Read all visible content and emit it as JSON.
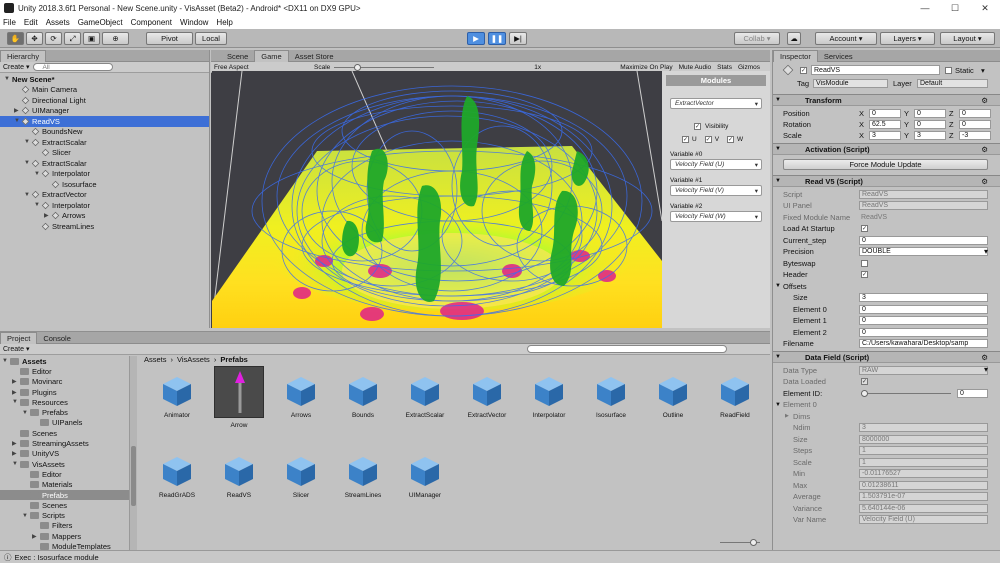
{
  "window": {
    "title": "Unity 2018.3.6f1 Personal - New Scene.unity - VisAsset (Beta2) - Android* <DX11 on DX9 GPU>"
  },
  "menu": [
    "File",
    "Edit",
    "Assets",
    "GameObject",
    "Component",
    "Window",
    "Help"
  ],
  "toolbar": {
    "pivot": "Pivot",
    "local": "Local",
    "collab": "Collab",
    "account": "Account",
    "layers": "Layers",
    "layout": "Layout"
  },
  "hierarchy": {
    "tab": "Hierarchy",
    "create": "Create",
    "search": "All",
    "items": [
      {
        "label": "New Scene*",
        "depth": 0,
        "bold": true,
        "exp": "▼",
        "cube": false
      },
      {
        "label": "Main Camera",
        "depth": 1,
        "exp": "",
        "cube": true
      },
      {
        "label": "Directional Light",
        "depth": 1,
        "exp": "",
        "cube": true
      },
      {
        "label": "UIManager",
        "depth": 1,
        "exp": "▶",
        "cube": true
      },
      {
        "label": "ReadVS",
        "depth": 1,
        "exp": "▼",
        "cube": true,
        "sel": true
      },
      {
        "label": "BoundsNew",
        "depth": 2,
        "exp": "",
        "cube": true
      },
      {
        "label": "ExtractScalar",
        "depth": 2,
        "exp": "▼",
        "cube": true
      },
      {
        "label": "Slicer",
        "depth": 3,
        "exp": "",
        "cube": true
      },
      {
        "label": "ExtractScalar",
        "depth": 2,
        "exp": "▼",
        "cube": true
      },
      {
        "label": "Interpolator",
        "depth": 3,
        "exp": "▼",
        "cube": true
      },
      {
        "label": "Isosurface",
        "depth": 4,
        "exp": "",
        "cube": true
      },
      {
        "label": "ExtractVector",
        "depth": 2,
        "exp": "▼",
        "cube": true
      },
      {
        "label": "Interpolator",
        "depth": 3,
        "exp": "▼",
        "cube": true
      },
      {
        "label": "Arrows",
        "depth": 4,
        "exp": "▶",
        "cube": true
      },
      {
        "label": "StreamLines",
        "depth": 3,
        "exp": "",
        "cube": true
      }
    ]
  },
  "scene_tabs": [
    "Scene",
    "Game",
    "Asset Store"
  ],
  "game": {
    "aspect": "Free Aspect",
    "scale_label": "Scale",
    "scale_value": "1x",
    "toggles": [
      "Maximize On Play",
      "Mute Audio",
      "Stats",
      "Gizmos"
    ],
    "modules": {
      "title": "Modules",
      "module_select": "ExtractVector",
      "visibility": "Visibility",
      "uvw": [
        "U",
        "V",
        "W"
      ],
      "variables": [
        {
          "label": "Variable #0",
          "value": "Velocity Field (U)"
        },
        {
          "label": "Variable #1",
          "value": "Velocity Field (V)"
        },
        {
          "label": "Variable #2",
          "value": "Velocity Field (W)"
        }
      ]
    }
  },
  "project": {
    "tabs": [
      "Project",
      "Console"
    ],
    "create": "Create",
    "breadcrumb": [
      "Assets",
      "VisAssets",
      "Prefabs"
    ],
    "tree": [
      {
        "label": "Assets",
        "depth": 0,
        "exp": "▼",
        "bold": true
      },
      {
        "label": "Editor",
        "depth": 1,
        "exp": ""
      },
      {
        "label": "Movinarc",
        "depth": 1,
        "exp": "▶"
      },
      {
        "label": "Plugins",
        "depth": 1,
        "exp": "▶"
      },
      {
        "label": "Resources",
        "depth": 1,
        "exp": "▼"
      },
      {
        "label": "Prefabs",
        "depth": 2,
        "exp": "▼"
      },
      {
        "label": "UIPanels",
        "depth": 3,
        "exp": ""
      },
      {
        "label": "Scenes",
        "depth": 1,
        "exp": ""
      },
      {
        "label": "StreamingAssets",
        "depth": 1,
        "exp": "▶"
      },
      {
        "label": "UnityVS",
        "depth": 1,
        "exp": "▶"
      },
      {
        "label": "VisAssets",
        "depth": 1,
        "exp": "▼"
      },
      {
        "label": "Editor",
        "depth": 2,
        "exp": ""
      },
      {
        "label": "Materials",
        "depth": 2,
        "exp": ""
      },
      {
        "label": "Prefabs",
        "depth": 2,
        "exp": "",
        "sel": true
      },
      {
        "label": "Scenes",
        "depth": 2,
        "exp": ""
      },
      {
        "label": "Scripts",
        "depth": 2,
        "exp": "▼"
      },
      {
        "label": "Filters",
        "depth": 3,
        "exp": ""
      },
      {
        "label": "Mappers",
        "depth": 3,
        "exp": "▶"
      },
      {
        "label": "ModuleTemplates",
        "depth": 3,
        "exp": ""
      }
    ],
    "assets": [
      "Animator",
      "Arrow",
      "Arrows",
      "Bounds",
      "ExtractScalar",
      "ExtractVector",
      "Interpolator",
      "Isosurface",
      "Outline",
      "ReadField",
      "ReadGrADS",
      "ReadVS",
      "Slicer",
      "StreamLines",
      "UIManager"
    ]
  },
  "inspector": {
    "tabs": [
      "Inspector",
      "Services"
    ],
    "object_name": "ReadVS",
    "static_label": "Static",
    "tag_label": "Tag",
    "tag": "VisModule",
    "layer_label": "Layer",
    "layer": "Default",
    "transform": {
      "title": "Transform",
      "rows": [
        {
          "label": "Position",
          "x": "0",
          "y": "0",
          "z": "0"
        },
        {
          "label": "Rotation",
          "x": "62.5",
          "y": "0",
          "z": "0"
        },
        {
          "label": "Scale",
          "x": "3",
          "y": "3",
          "z": "-3"
        }
      ]
    },
    "activation": {
      "title": "Activation (Script)",
      "button": "Force Module Update"
    },
    "readvs": {
      "title": "Read V5 (Script)",
      "rows": [
        {
          "label": "Script",
          "value": "ReadVS",
          "dis": true
        },
        {
          "label": "UI Panel",
          "value": "ReadVS",
          "dis": true
        },
        {
          "label": "Fixed Module Name",
          "value": "ReadVS",
          "dis": true,
          "plain": true
        },
        {
          "label": "Load At Startup",
          "check": "✓"
        },
        {
          "label": "Current_step",
          "value": "0"
        },
        {
          "label": "Precision",
          "value": "DOUBLE",
          "select": true
        },
        {
          "label": "Byteswap",
          "check": ""
        },
        {
          "label": "Header",
          "check": "✓"
        },
        {
          "label": "Offsets",
          "section": true
        },
        {
          "label": "Size",
          "value": "3",
          "indent": true
        },
        {
          "label": "Element 0",
          "value": "0",
          "indent": true
        },
        {
          "label": "Element 1",
          "value": "0",
          "indent": true
        },
        {
          "label": "Element 2",
          "value": "0",
          "indent": true
        },
        {
          "label": "Filename",
          "value": "C:/Users/kawahara/Desktop/samp"
        }
      ]
    },
    "datafield": {
      "title": "Data Field (Script)",
      "rows": [
        {
          "label": "Data Type",
          "value": "RAW",
          "dis": true,
          "select": true
        },
        {
          "label": "Data Loaded",
          "check": "✓",
          "dis": true
        },
        {
          "label": "Element ID:",
          "value": "0",
          "slider": true
        },
        {
          "label": "Element 0",
          "section": true,
          "dis": true
        },
        {
          "label": "Dims",
          "value": "",
          "dis": true,
          "indent": true,
          "nofield": true
        },
        {
          "label": "Ndim",
          "value": "3",
          "dis": true,
          "indent": true
        },
        {
          "label": "Size",
          "value": "8000000",
          "dis": true,
          "indent": true
        },
        {
          "label": "Steps",
          "value": "1",
          "dis": true,
          "indent": true
        },
        {
          "label": "Scale",
          "value": "1",
          "dis": true,
          "indent": true
        },
        {
          "label": "Min",
          "value": "-0.01176527",
          "dis": true,
          "indent": true
        },
        {
          "label": "Max",
          "value": "0.01238611",
          "dis": true,
          "indent": true
        },
        {
          "label": "Average",
          "value": "1.503791e-07",
          "dis": true,
          "indent": true
        },
        {
          "label": "Variance",
          "value": "5.640144e-06",
          "dis": true,
          "indent": true
        },
        {
          "label": "Var Name",
          "value": "Velocity Field (U)",
          "dis": true,
          "indent": true
        }
      ]
    }
  },
  "status": "Exec : Isosurface module"
}
